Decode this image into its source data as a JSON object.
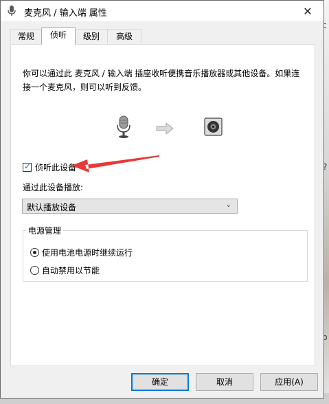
{
  "window": {
    "title": "麦克风 / 输入端 属性",
    "close_glyph": "✕"
  },
  "tabs": [
    {
      "label": "常规",
      "active": false
    },
    {
      "label": "侦听",
      "active": true
    },
    {
      "label": "级别",
      "active": false
    },
    {
      "label": "高级",
      "active": false
    }
  ],
  "listen": {
    "description": "你可以通过此 麦克风 / 输入端 插座收听便携音乐播放器或其他设备。如果连接一个麦克风，则可以听到反馈。",
    "illustration": {
      "source_icon": "microphone-icon",
      "arrow_icon": "arrow-right-icon",
      "target_icon": "speaker-icon"
    },
    "checkbox_label": "侦听此设备",
    "checkbox_checked": true,
    "playback_label": "通过此设备播放:",
    "playback_selected": "默认播放设备"
  },
  "power": {
    "group_title": "电源管理",
    "options": [
      {
        "label": "使用电池电源时继续运行",
        "selected": true
      },
      {
        "label": "自动禁用以节能",
        "selected": false
      }
    ]
  },
  "buttons": {
    "ok": "确定",
    "cancel": "取消",
    "apply": "应用(A)"
  },
  "annotation": {
    "color": "#e8393a"
  },
  "background_glyphs": {
    "top_left": "运",
    "right_top": "c",
    "right_mid": "?",
    "right_bottom": "b"
  }
}
